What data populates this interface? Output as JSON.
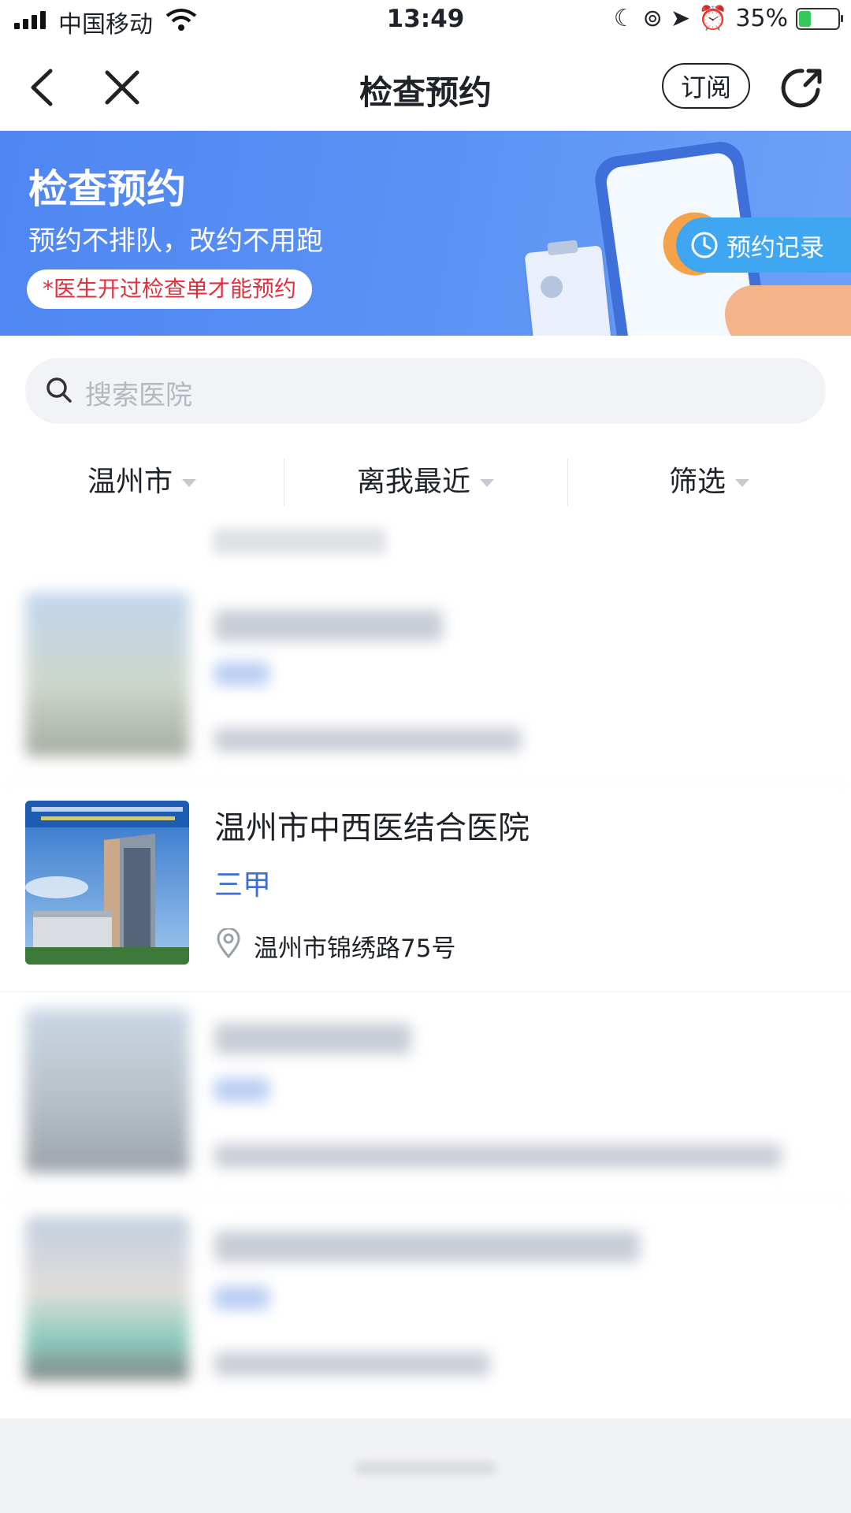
{
  "status_bar": {
    "carrier": "中国移动",
    "time": "13:49",
    "battery": "35%",
    "battery_level": 0.35
  },
  "nav": {
    "title": "检查预约",
    "subscribe_label": "订阅"
  },
  "banner": {
    "title": "检查预约",
    "subtitle": "预约不排队，改约不用跑",
    "note": "*医生开过检查单才能预约",
    "record_label": "预约记录"
  },
  "search": {
    "placeholder": "搜索医院"
  },
  "filters": [
    "温州市",
    "离我最近",
    "筛选"
  ],
  "hospital": {
    "name": "温州市中西医结合医院",
    "level": "三甲",
    "address": "温州市锦绣路75号"
  },
  "colors": {
    "accent": "#3a6fd8",
    "banner": "#5c93f5",
    "note_red": "#e0323e"
  }
}
